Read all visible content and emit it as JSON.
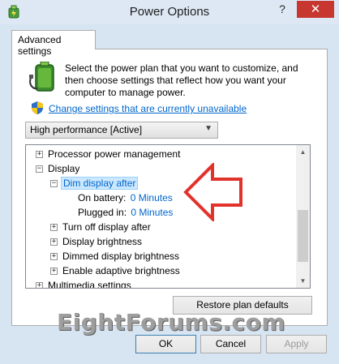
{
  "window": {
    "title": "Power Options",
    "help_label": "?",
    "close_label": "✕"
  },
  "tab": {
    "label": "Advanced settings"
  },
  "intro": {
    "text": "Select the power plan that you want to customize, and then choose settings that reflect how you want your computer to manage power."
  },
  "change_link": "Change settings that are currently unavailable",
  "plan_select": {
    "value": "High performance [Active]"
  },
  "tree": {
    "processor": "Processor power management",
    "display": "Display",
    "dim_after": "Dim display after",
    "on_battery_label": "On battery:",
    "on_battery_value": "0 Minutes",
    "plugged_in_label": "Plugged in:",
    "plugged_in_value": "0 Minutes",
    "turn_off_display": "Turn off display after",
    "display_brightness": "Display brightness",
    "dimmed_brightness": "Dimmed display brightness",
    "adaptive_brightness": "Enable adaptive brightness",
    "multimedia": "Multimedia settings",
    "expand_symbol": "+",
    "collapse_symbol": "−"
  },
  "buttons": {
    "restore": "Restore plan defaults",
    "ok": "OK",
    "cancel": "Cancel",
    "apply": "Apply"
  },
  "watermark": "EightForums.com",
  "colors": {
    "accent_link": "#0066cc",
    "arrow_red": "#e2322c",
    "close_red": "#c7372f"
  },
  "icons": [
    "power-options-icon",
    "battery-icon",
    "uac-shield-icon",
    "red-arrow-annotation"
  ]
}
